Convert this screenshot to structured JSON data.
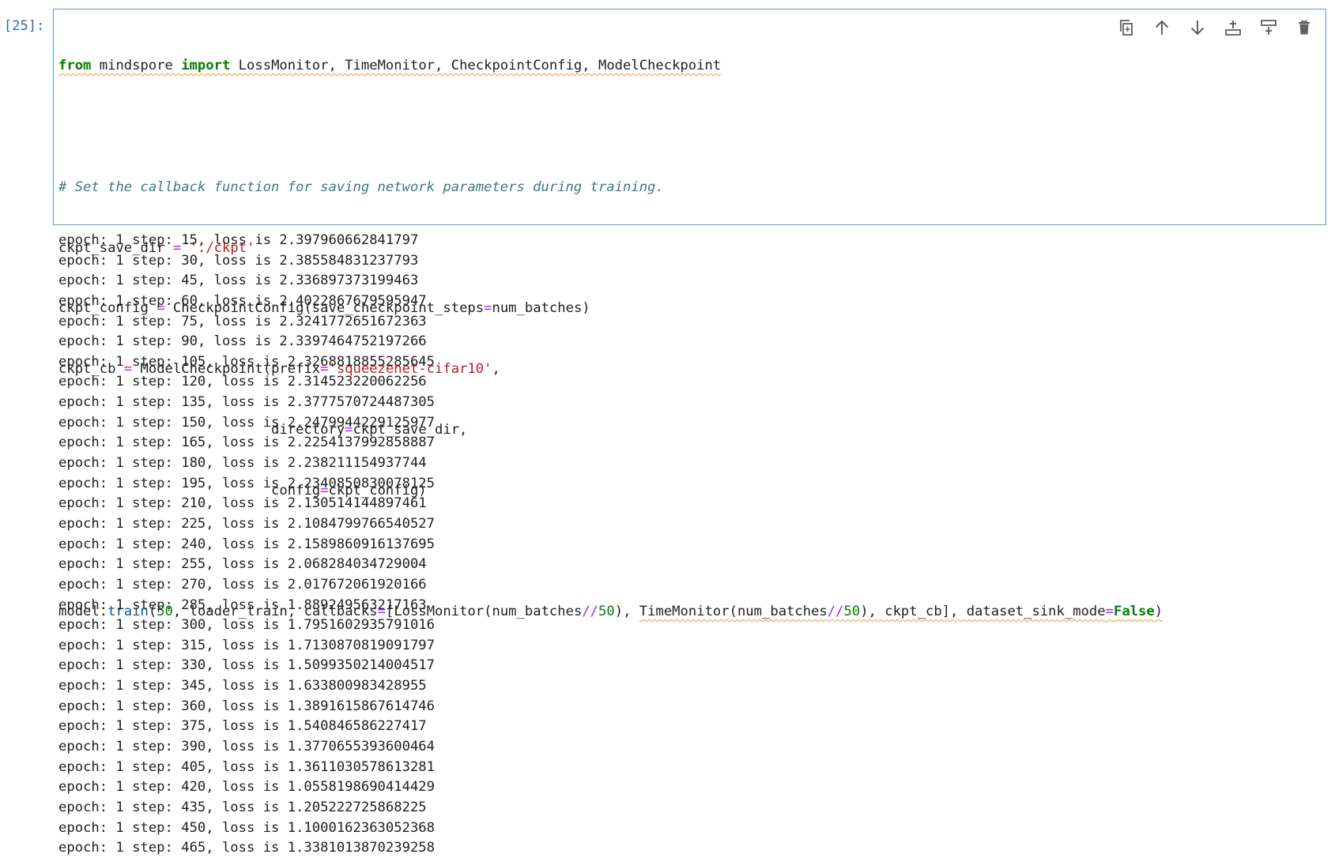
{
  "cell": {
    "prompt": "[25]:",
    "code": {
      "line1": {
        "kw_from": "from",
        "module": " mindspore ",
        "kw_import": "import",
        "names": " LossMonitor, TimeMonitor, CheckpointConfig, ModelCheckpoint"
      },
      "line3_comment": "# Set the callback function for saving network parameters during training.",
      "line4": {
        "var": "ckpt_save_dir ",
        "eq": "=",
        "sp": " ",
        "str": "'./ckpt'"
      },
      "line5": {
        "var": "ckpt_config ",
        "eq": "=",
        "call": " CheckpointConfig(save_checkpoint_steps",
        "eq2": "=",
        "rest": "num_batches)"
      },
      "line6": {
        "var": "ckpt_cb ",
        "eq": "=",
        "call": " ModelCheckpoint(prefix",
        "eq2": "=",
        "str": "'squeezenet-cifar10'",
        "rest": ","
      },
      "line7": {
        "indent": "                          directory",
        "eq": "=",
        "rest": "ckpt_save_dir,"
      },
      "line8": {
        "indent": "                          config",
        "eq": "=",
        "rest": "ckpt_config)"
      },
      "line10": {
        "obj": "model.",
        "method": "train",
        "p1": "(",
        "n50": "50",
        "p2": ", loader_train, callbacks",
        "eq": "=",
        "p3": "[LossMonitor(num_batches",
        "div": "//",
        "n50b": "50",
        "p4": "), ",
        "squig_part1": "TimeMonitor(num_batches",
        "div2": "//",
        "n50c": "50",
        "squig_part2": "), ckpt_cb], dataset_sink_mode",
        "eq2": "=",
        "kw_false": "False",
        "close": ")"
      }
    }
  },
  "toolbar": {
    "icons": [
      "duplicate-icon",
      "move-up-icon",
      "move-down-icon",
      "insert-above-icon",
      "insert-below-icon",
      "delete-icon"
    ]
  },
  "output": {
    "lines": [
      "epoch: 1 step: 15, loss is 2.397960662841797",
      "epoch: 1 step: 30, loss is 2.385584831237793",
      "epoch: 1 step: 45, loss is 2.336897373199463",
      "epoch: 1 step: 60, loss is 2.4022867679595947",
      "epoch: 1 step: 75, loss is 2.3241772651672363",
      "epoch: 1 step: 90, loss is 2.3397464752197266",
      "epoch: 1 step: 105, loss is 2.3268818855285645",
      "epoch: 1 step: 120, loss is 2.314523220062256",
      "epoch: 1 step: 135, loss is 2.3777570724487305",
      "epoch: 1 step: 150, loss is 2.2479944229125977",
      "epoch: 1 step: 165, loss is 2.2254137992858887",
      "epoch: 1 step: 180, loss is 2.238211154937744",
      "epoch: 1 step: 195, loss is 2.2340850830078125",
      "epoch: 1 step: 210, loss is 2.130514144897461",
      "epoch: 1 step: 225, loss is 2.1084799766540527",
      "epoch: 1 step: 240, loss is 2.1589860916137695",
      "epoch: 1 step: 255, loss is 2.068284034729004",
      "epoch: 1 step: 270, loss is 2.017672061920166",
      "epoch: 1 step: 285, loss is 1.889249563217163",
      "epoch: 1 step: 300, loss is 1.7951602935791016",
      "epoch: 1 step: 315, loss is 1.7130870819091797",
      "epoch: 1 step: 330, loss is 1.5099350214004517",
      "epoch: 1 step: 345, loss is 1.633800983428955",
      "epoch: 1 step: 360, loss is 1.3891615867614746",
      "epoch: 1 step: 375, loss is 1.540846586227417",
      "epoch: 1 step: 390, loss is 1.3770655393600464",
      "epoch: 1 step: 405, loss is 1.3611030578613281",
      "epoch: 1 step: 420, loss is 1.0558198690414429",
      "epoch: 1 step: 435, loss is 1.205222725868225",
      "epoch: 1 step: 450, loss is 1.1000162363052368",
      "epoch: 1 step: 465, loss is 1.3381013870239258"
    ]
  }
}
